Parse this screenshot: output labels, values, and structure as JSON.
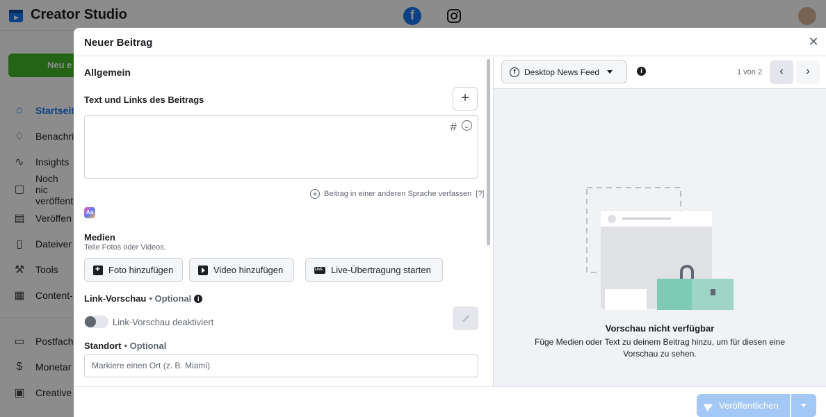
{
  "app": {
    "name": "Creator Studio",
    "new_button": "Neu e",
    "nav": [
      {
        "label": "Startseite",
        "icon": "home-icon"
      },
      {
        "label": "Benachri",
        "icon": "bell-icon"
      },
      {
        "label": "Insights",
        "icon": "insights-icon"
      },
      {
        "label": "Noch nic veröffent",
        "icon": "draft-icon"
      },
      {
        "label": "Veröffen",
        "icon": "published-icon"
      },
      {
        "label": "Dateiver",
        "icon": "file-icon"
      },
      {
        "label": "Tools",
        "icon": "tools-icon"
      },
      {
        "label": "Content-",
        "icon": "content-icon"
      },
      {
        "label": "Postfach",
        "icon": "inbox-icon"
      },
      {
        "label": "Monetar",
        "icon": "dollar-icon"
      },
      {
        "label": "Creative",
        "icon": "creative-icon"
      }
    ]
  },
  "modal": {
    "title": "Neuer Beitrag",
    "section_general": "Allgemein",
    "text_label": "Text und Links des Beitrags",
    "hash_symbol": "#",
    "lang_link": "Beitrag in einer anderen Sprache verfassen",
    "lang_help": "[?]",
    "aa_label": "Aa",
    "media_title": "Medien",
    "media_sub": "Teile Fotos oder Videos.",
    "btn_photo": "Foto hinzufügen",
    "btn_video": "Video hinzufügen",
    "btn_live": "Live-Übertragung starten",
    "link_preview_title": "Link-Vorschau",
    "optional": "• Optional",
    "link_preview_toggle": "Link-Vorschau deaktiviert",
    "location_title": "Standort",
    "location_placeholder": "Markiere einen Ort (z. B. Miami)",
    "feed_select": "Desktop News Feed",
    "pager": "1 von 2",
    "preview_title": "Vorschau nicht verfügbar",
    "preview_sub": "Füge Medien oder Text zu deinem Beitrag hinzu, um für diesen eine Vorschau zu sehen.",
    "publish": "Veröffentlichen"
  }
}
